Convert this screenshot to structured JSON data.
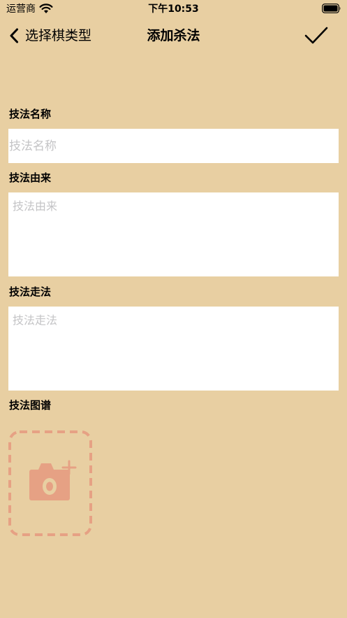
{
  "status_bar": {
    "carrier": "运营商",
    "time": "下午10:53"
  },
  "nav": {
    "back_label": "选择棋类型",
    "title": "添加杀法"
  },
  "form": {
    "name_label": "技法名称",
    "name_placeholder": "技法名称",
    "origin_label": "技法由来",
    "origin_placeholder": "技法由来",
    "moves_label": "技法走法",
    "moves_placeholder": "技法走法",
    "diagram_label": "技法图谱"
  },
  "colors": {
    "background": "#e8cfa2",
    "input_background": "#ffffff",
    "placeholder": "#c4c4c6",
    "accent": "#e6a184"
  },
  "icons": {
    "back": "chevron-left-icon",
    "done": "checkmark-icon",
    "add_photo": "camera-plus-icon"
  }
}
